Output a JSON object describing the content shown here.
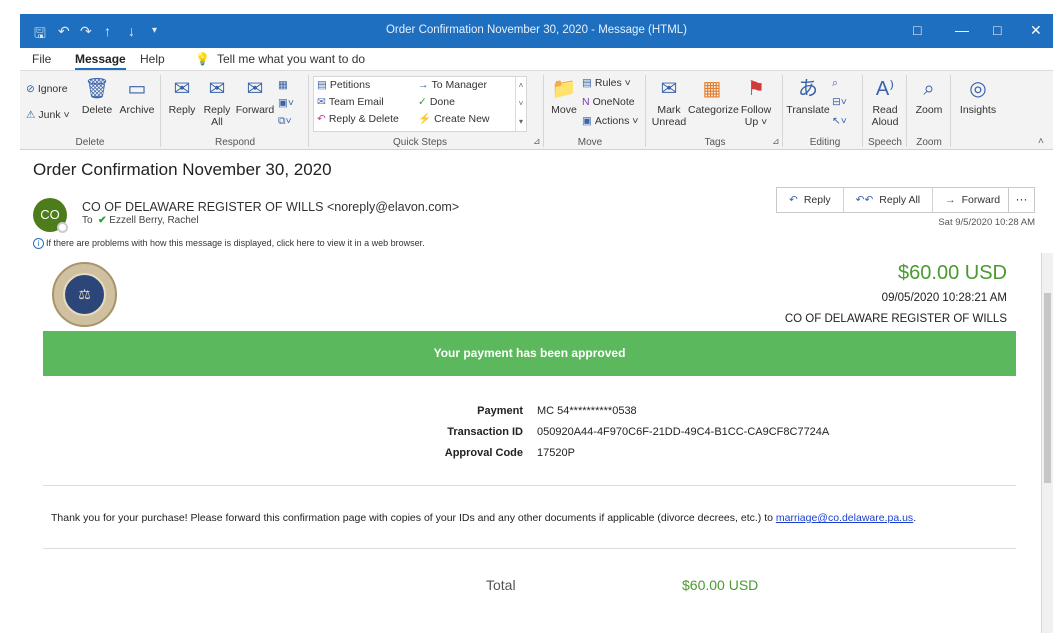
{
  "window": {
    "title": "Order Confirmation November 30, 2020  -  Message (HTML)",
    "controls": [
      "□",
      "—",
      "□",
      "✕"
    ]
  },
  "menu": {
    "items": [
      "File",
      "Message",
      "Help"
    ],
    "tell_me": "Tell me what you want to do"
  },
  "ribbon": {
    "delete": {
      "ignore": "Ignore",
      "junk": "Junk ˅",
      "delete": "Delete",
      "archive": "Archive",
      "group": "Delete"
    },
    "respond": {
      "reply": "Reply",
      "reply_all": "Reply All",
      "forward": "Forward",
      "group": "Respond"
    },
    "quick_steps": {
      "items": [
        "Petitions",
        "Team Email",
        "Reply & Delete",
        "To Manager",
        "Done",
        "Create New"
      ],
      "group": "Quick Steps"
    },
    "move": {
      "move": "Move",
      "rules": "Rules ˅",
      "onenote": "OneNote",
      "actions": "Actions ˅",
      "group": "Move"
    },
    "tags": {
      "mark_unread": "Mark Unread",
      "categorize": "Categorize",
      "follow_up": "Follow Up ˅",
      "group": "Tags"
    },
    "editing": {
      "translate": "Translate",
      "group": "Editing"
    },
    "speech": {
      "read_aloud": "Read Aloud",
      "group": "Speech"
    },
    "zoom": {
      "zoom": "Zoom",
      "group": "Zoom"
    },
    "insights": {
      "label": "Insights"
    }
  },
  "message": {
    "subject": "Order Confirmation November 30, 2020",
    "avatar_initials": "CO",
    "sender": "CO OF DELAWARE REGISTER OF WILLS <noreply@elavon.com>",
    "to_label": "To",
    "recipient": "Ezzell Berry, Rachel",
    "date": "Sat 9/5/2020 10:28 AM",
    "info_bar": "If there are problems with how this message is displayed, click here to view it in a web browser.",
    "actions": {
      "reply": "Reply",
      "reply_all": "Reply All",
      "forward": "Forward",
      "more": "···"
    }
  },
  "receipt": {
    "amount": "$60.00 USD",
    "timestamp": "09/05/2020 10:28:21 AM",
    "merchant": "CO OF DELAWARE REGISTER OF WILLS",
    "banner": "Your payment has been approved",
    "details": [
      {
        "label": "Payment",
        "value": "MC  54**********0538"
      },
      {
        "label": "Transaction ID",
        "value": "050920A44-4F970C6F-21DD-49C4-B1CC-CA9CF8C7724A"
      },
      {
        "label": "Approval Code",
        "value": "17520P"
      }
    ],
    "thanks_text": "Thank you for your purchase! Please forward this confirmation page with copies of your IDs and any other documents if applicable (divorce decrees, etc.) to ",
    "email_link": "marriage@co.delaware.pa.us",
    "thanks_end": ".",
    "total_label": "Total",
    "total_value": "$60.00 USD"
  },
  "colors": {
    "accent": "#1e6fc0",
    "success": "#5cb85c",
    "amount_green": "#4a9a2f",
    "avatar": "#4d7d1a"
  }
}
